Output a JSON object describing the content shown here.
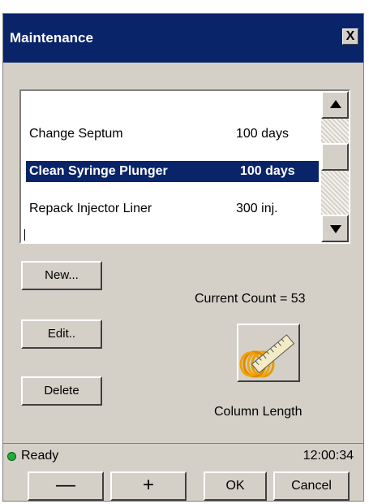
{
  "window": {
    "title": "Maintenance",
    "close_label": "X"
  },
  "list": {
    "items": [
      {
        "name": "Change Septum",
        "value": "100  days",
        "selected": false
      },
      {
        "name": "Clean Syringe Plunger",
        "value": "100 days",
        "selected": true
      },
      {
        "name": "Repack Injector Liner",
        "value": "300  inj.",
        "selected": false
      }
    ]
  },
  "actions": {
    "new_label": "New...",
    "edit_label": "Edit..",
    "delete_label": "Delete"
  },
  "counter": {
    "text": "Current Count = 53"
  },
  "tool": {
    "icon": "column-ruler-icon",
    "label": "Column Length"
  },
  "status": {
    "text": "Ready",
    "time": "12:00:34",
    "indicator_color": "#1fae3a"
  },
  "footer": {
    "minus_label": "—",
    "plus_label": "+",
    "ok_label": "OK",
    "cancel_label": "Cancel"
  },
  "colors": {
    "titlebar": "#0a246a",
    "dialog": "#d4d0c8",
    "selection": "#0a246a"
  }
}
